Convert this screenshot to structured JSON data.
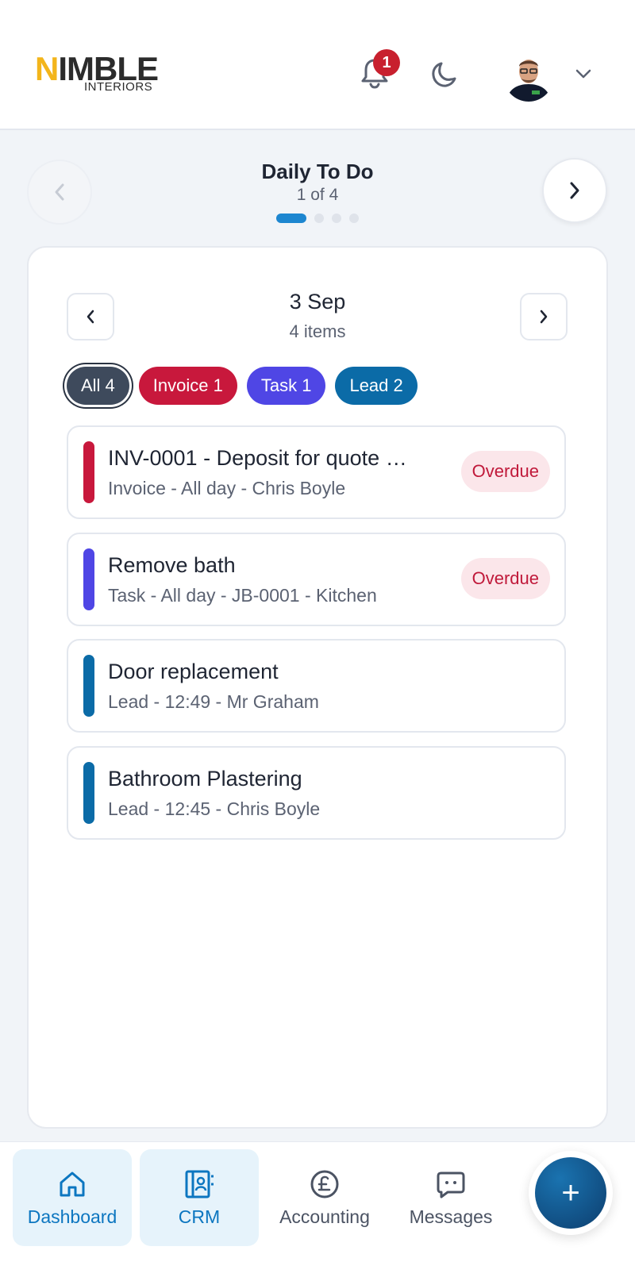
{
  "header": {
    "logo_text": "NIMBLE",
    "logo_sub": "INTERIORS",
    "notification_count": "1",
    "icons": [
      "bell-icon",
      "moon-icon",
      "avatar",
      "chevron-down-icon"
    ]
  },
  "carousel": {
    "title": "Daily To Do",
    "subtitle": "1 of 4",
    "active_index": 0,
    "total": 4
  },
  "day": {
    "date": "3 Sep",
    "count": "4 items"
  },
  "filters": [
    {
      "label": "All 4",
      "type": "all",
      "color": "#3e4a5c"
    },
    {
      "label": "Invoice 1",
      "type": "invoice",
      "color": "#c8183c"
    },
    {
      "label": "Task 1",
      "type": "task",
      "color": "#4f46e5"
    },
    {
      "label": "Lead 2",
      "type": "lead",
      "color": "#0b6ba7"
    }
  ],
  "items": [
    {
      "title": "INV-0001 - Deposit for quote …",
      "meta": "Invoice - All day - Chris Boyle",
      "status": "Overdue",
      "color": "#c8183c"
    },
    {
      "title": "Remove bath",
      "meta": "Task - All day - JB-0001 - Kitchen",
      "status": "Overdue",
      "color": "#4f46e5"
    },
    {
      "title": "Door replacement",
      "meta": "Lead - 12:49 - Mr Graham",
      "status": "",
      "color": "#0b6ba7"
    },
    {
      "title": "Bathroom Plastering",
      "meta": "Lead - 12:45 - Chris Boyle",
      "status": "",
      "color": "#0b6ba7"
    }
  ],
  "bottom_nav": [
    {
      "label": "Dashboard",
      "icon": "home-icon",
      "active": true
    },
    {
      "label": "CRM",
      "icon": "contacts-icon",
      "active": true
    },
    {
      "label": "Accounting",
      "icon": "pound-icon",
      "active": false
    },
    {
      "label": "Messages",
      "icon": "message-icon",
      "active": false
    }
  ],
  "fab_label": "+"
}
